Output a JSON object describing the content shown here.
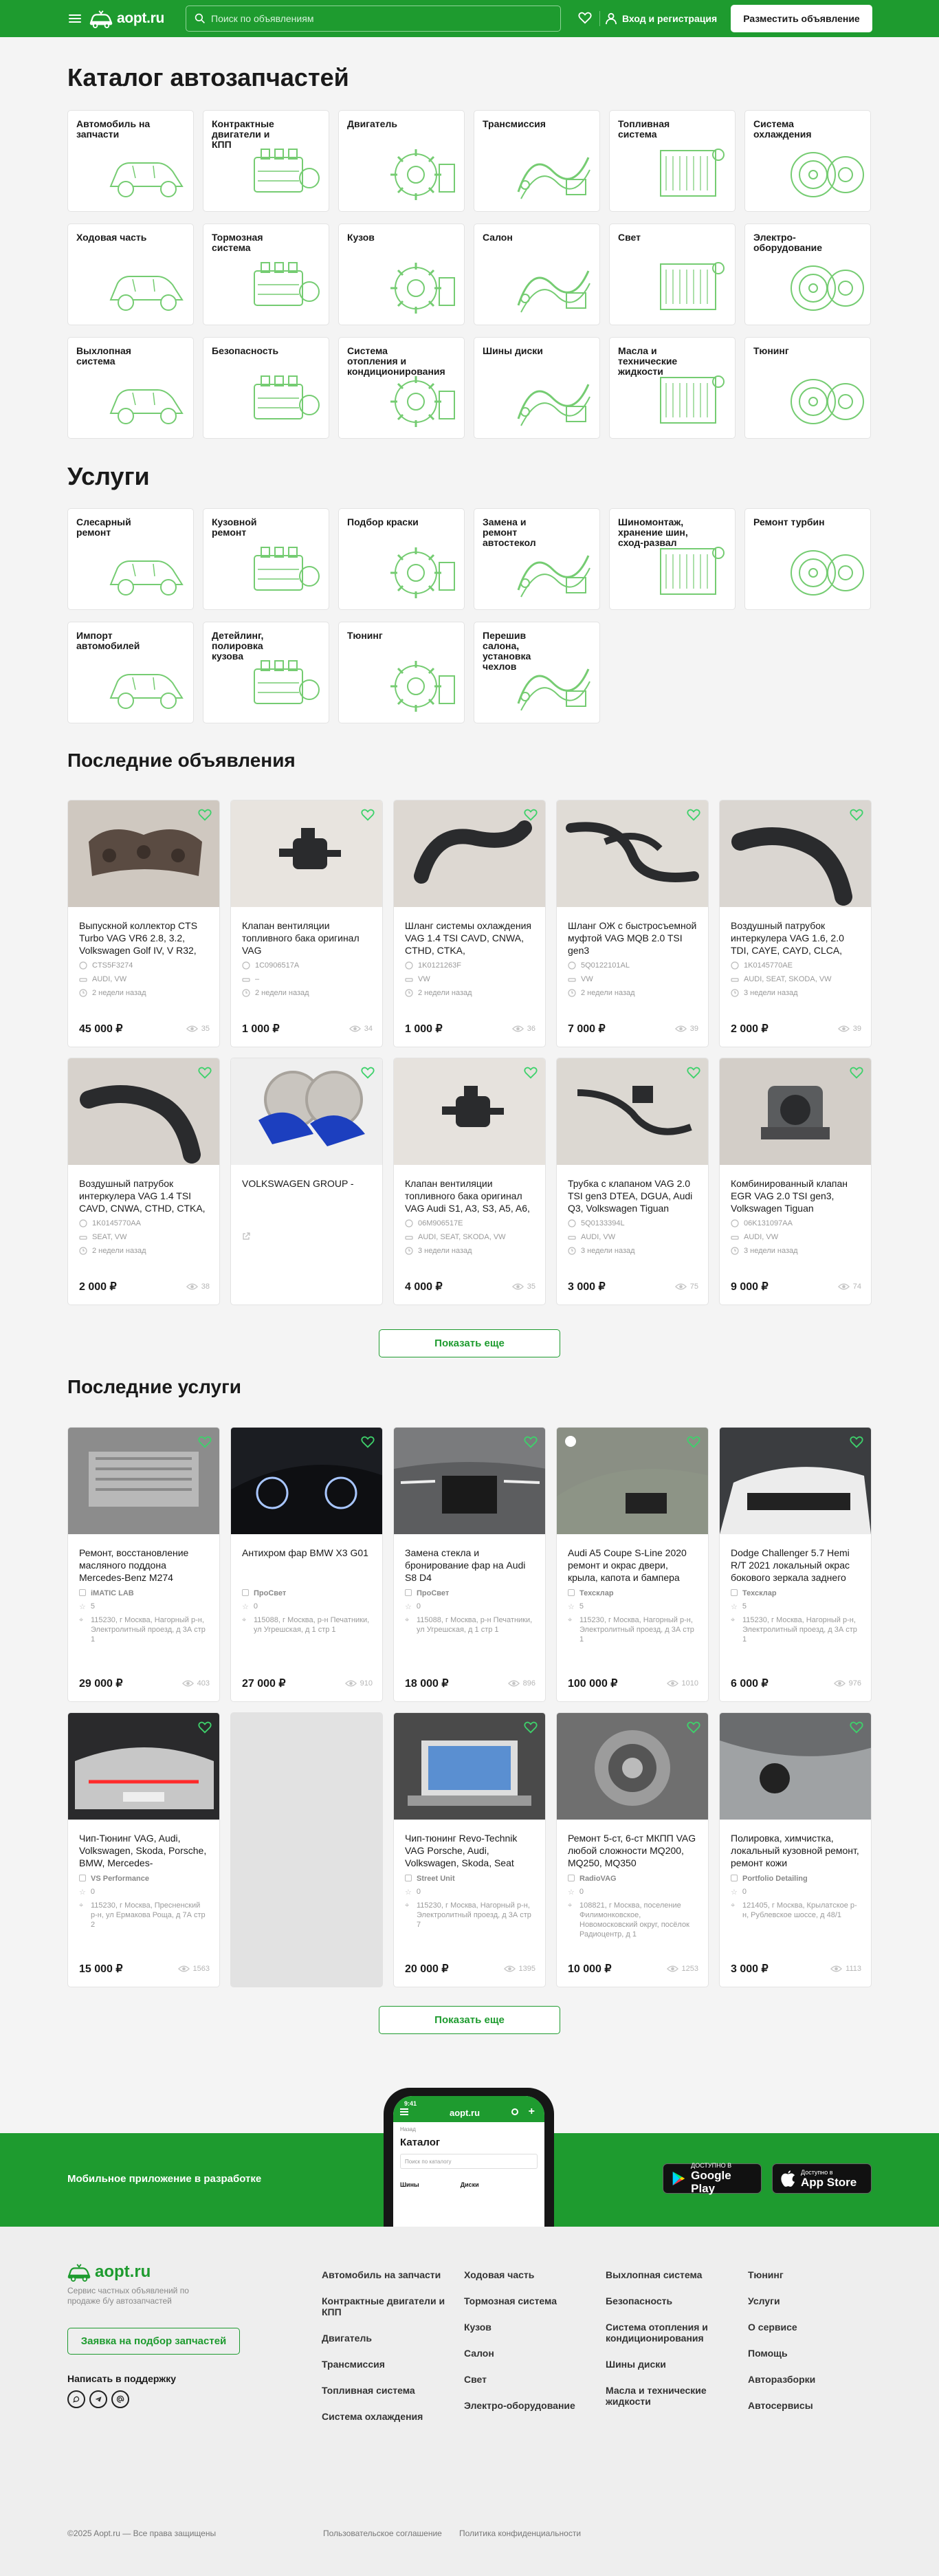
{
  "header": {
    "logo_text": "aopt.ru",
    "search_placeholder": "Поиск по объявлениям",
    "login_label": "Вход и регистрация",
    "post_button": "Разместить объявление"
  },
  "catalog": {
    "title": "Каталог автозапчастей",
    "items": [
      {
        "label": "Автомобиль на запчасти",
        "icon": "car-parts-icon"
      },
      {
        "label": "Контрактные двигатели и КПП",
        "icon": "engine-gearbox-icon"
      },
      {
        "label": "Двигатель",
        "icon": "engine-icon"
      },
      {
        "label": "Трансмиссия",
        "icon": "transmission-icon"
      },
      {
        "label": "Топливная система",
        "icon": "fuel-system-icon"
      },
      {
        "label": "Система охлаждения",
        "icon": "cooling-system-icon"
      },
      {
        "label": "Ходовая часть",
        "icon": "suspension-icon"
      },
      {
        "label": "Тормозная система",
        "icon": "brake-icon"
      },
      {
        "label": "Кузов",
        "icon": "car-body-icon"
      },
      {
        "label": "Салон",
        "icon": "car-interior-icon"
      },
      {
        "label": "Свет",
        "icon": "headlight-icon"
      },
      {
        "label": "Электро-оборудование",
        "icon": "electrical-icon"
      },
      {
        "label": "Выхлопная система",
        "icon": "exhaust-icon"
      },
      {
        "label": "Безопасность",
        "icon": "safety-icon"
      },
      {
        "label": "Система отопления и кондиционирования",
        "icon": "ac-heating-icon"
      },
      {
        "label": "Шины диски",
        "icon": "tires-wheels-icon"
      },
      {
        "label": "Масла и технические жидкости",
        "icon": "oils-fluids-icon"
      },
      {
        "label": "Тюнинг",
        "icon": "tuning-icon"
      }
    ]
  },
  "services": {
    "title": "Услуги",
    "items": [
      {
        "label": "Слесарный ремонт",
        "icon": "mechanic-icon"
      },
      {
        "label": "Кузовной ремонт",
        "icon": "body-repair-icon"
      },
      {
        "label": "Подбор краски",
        "icon": "paint-match-icon"
      },
      {
        "label": "Замена и ремонт автостекол",
        "icon": "windshield-icon"
      },
      {
        "label": "Шиномонтаж, хранение шин, сход-развал",
        "icon": "tire-service-icon"
      },
      {
        "label": "Ремонт турбин",
        "icon": "turbo-icon"
      },
      {
        "label": "Импорт автомобилей",
        "icon": "car-import-icon"
      },
      {
        "label": "Детейлинг, полировка кузова",
        "icon": "detailing-icon"
      },
      {
        "label": "Тюнинг",
        "icon": "tuning-service-icon"
      },
      {
        "label": "Перешив салона, установка чехлов",
        "icon": "upholstery-icon"
      }
    ]
  },
  "listings": {
    "title": "Последние объявления",
    "show_more": "Показать еще",
    "items": [
      {
        "title": "Выпускной коллектор CTS Turbo VAG VR6 2.8, 3.2, Volkswagen Golf IV, V R32,",
        "code": "CTS5F3274",
        "brands": "AUDI, VW",
        "date": "2 недели назад",
        "price": "45 000 ₽",
        "views": "35",
        "img": "manifold"
      },
      {
        "title": "Клапан вентиляции топливного бака оригинал VAG",
        "code": "1C0906517A",
        "brands": "–",
        "date": "2 недели назад",
        "price": "1 000 ₽",
        "views": "34",
        "img": "valve"
      },
      {
        "title": "Шланг системы охлаждения VAG 1.4 TSI CAVD, CNWA, CTHD, CTKA,",
        "code": "1K0121263F",
        "brands": "VW",
        "date": "2 недели назад",
        "price": "1 000 ₽",
        "views": "36",
        "img": "hose"
      },
      {
        "title": "Шланг ОЖ с быстросъемной муфтой VAG MQB 2.0 TSI gen3",
        "code": "5Q0122101AL",
        "brands": "VW",
        "date": "2 недели назад",
        "price": "7 000 ₽",
        "views": "39",
        "img": "hose2"
      },
      {
        "title": "Воздушный патрубок интеркулера VAG 1.6, 2.0 TDI, CAYE, CAYD, CLCA,",
        "code": "1K0145770AE",
        "brands": "AUDI, SEAT, SKODA, VW",
        "date": "3 недели назад",
        "price": "2 000 ₽",
        "views": "39",
        "img": "pipe"
      },
      {
        "title": "Воздушный патрубок интеркулера VAG 1.4 TSI CAVD, CNWA, CTHD, CTKA,",
        "code": "1K0145770AA",
        "brands": "SEAT, VW",
        "date": "2 недели назад",
        "price": "2 000 ₽",
        "views": "38",
        "img": "pipe2"
      },
      {
        "title": "VOLKSWAGEN GROUP -",
        "code": "",
        "brands": "",
        "date": "",
        "price": "",
        "views": "",
        "img": "brakes"
      },
      {
        "title": "Клапан вентиляции топливного бака оригинал VAG Audi S1, A3, S3, A5, A6,",
        "code": "06M906517E",
        "brands": "AUDI, SEAT, SKODA, VW",
        "date": "3 недели назад",
        "price": "4 000 ₽",
        "views": "35",
        "img": "valve2"
      },
      {
        "title": "Трубка с клапаном VAG 2.0 TSI gen3 DTEA, DGUA, Audi Q3, Volkswagen Tiguan",
        "code": "5Q0133394L",
        "brands": "AUDI, VW",
        "date": "3 недели назад",
        "price": "3 000 ₽",
        "views": "75",
        "img": "tube"
      },
      {
        "title": "Комбинированный клапан EGR VAG 2.0 TSI gen3, Volkswagen Tiguan",
        "code": "06K131097AA",
        "brands": "AUDI, VW",
        "date": "3 недели назад",
        "price": "9 000 ₽",
        "views": "74",
        "img": "egr"
      }
    ]
  },
  "latest_services": {
    "title": "Последние услуги",
    "show_more": "Показать еще",
    "items": [
      {
        "title": "Ремонт, восстановление масляного поддона Mercedes-Benz M274",
        "seller": "iMATIC LAB",
        "rating": "5",
        "address": "115230, г Москва, Нагорный р-н, Электролитный проезд, д 3А стр 1",
        "price": "29 000 ₽",
        "views": "403",
        "img": "oilpan"
      },
      {
        "title": "Антихром фар BMW X3 G01",
        "seller": "ПроСвет",
        "rating": "0",
        "address": "115088, г Москва, р-н Печатники, ул Угрешская, д 1 стр 1",
        "price": "27 000 ₽",
        "views": "910",
        "img": "bmw"
      },
      {
        "title": "Замена стекла и бронирование фар на Audi S8 D4",
        "seller": "ПроСвет",
        "rating": "0",
        "address": "115088, г Москва, р-н Печатники, ул Угрешская, д 1 стр 1",
        "price": "18 000 ₽",
        "views": "896",
        "img": "audi"
      },
      {
        "title": "Audi A5 Coupe S-Line 2020 ремонт и окрас двери, крыла, капота и бампера",
        "seller": "Техсклар",
        "rating": "5",
        "address": "115230, г Москва, Нагорный р-н, Электролитный проезд, д 3А стр 1",
        "price": "100 000 ₽",
        "views": "1010",
        "img": "a5"
      },
      {
        "title": "Dodge Challenger 5.7 Hemi R/T 2021 локальный окрас бокового зеркала заднего",
        "seller": "Техсклар",
        "rating": "5",
        "address": "115230, г Москва, Нагорный р-н, Электролитный проезд, д 3А стр 1",
        "price": "6 000 ₽",
        "views": "976",
        "img": "dodge"
      },
      {
        "title": "Чип-Тюнинг VAG, Audi, Volkswagen, Skoda, Porsche, BMW, Mercedes-",
        "seller": "VS Performance",
        "rating": "0",
        "address": "115230, г Москва, Пресненский р-н, ул Ермакова Роща, д 7А стр 2",
        "price": "15 000 ₽",
        "views": "1563",
        "img": "audirear"
      },
      {
        "title": "",
        "seller": "",
        "rating": "",
        "address": "",
        "price": "",
        "views": "",
        "img": "blank"
      },
      {
        "title": "Чип-тюнинг Revo-Technik VAG Porsche, Audi, Volkswagen, Skoda, Seat",
        "seller": "Street Unit",
        "rating": "0",
        "address": "115230, г Москва, Нагорный р-н, Электролитный проезд, д 3А стр 7",
        "price": "20 000 ₽",
        "views": "1395",
        "img": "laptop"
      },
      {
        "title": "Ремонт 5-ст, 6-ст МКПП VAG любой сложности MQ200, MQ250, MQ350",
        "seller": "RadioVAG",
        "rating": "0",
        "address": "108821, г Москва, поселение Филимонковское, Новомосковский округ, посёлок Радиоцентр, д 1",
        "price": "10 000 ₽",
        "views": "1253",
        "img": "gearbox"
      },
      {
        "title": "Полировка, химчистка, локальный кузовной ремонт, ремонт кожи",
        "seller": "Portfolio Detailing",
        "rating": "0",
        "address": "121405, г Москва, Крылатское р-н, Рублевское шоссе, д 48/1",
        "price": "3 000 ₽",
        "views": "1113",
        "img": "polish"
      }
    ]
  },
  "mobile": {
    "text": "Мобильное приложение в разработке",
    "google_small": "ДОСТУПНО В",
    "google_big": "Google Play",
    "apple_small": "Доступно в",
    "apple_big": "App Store",
    "phone_time": "9:41",
    "phone_logo": "aopt.ru",
    "phone_back": "Назад",
    "phone_heading": "Каталог",
    "phone_search": "Поиск по каталогу",
    "phone_item1": "Шины",
    "phone_item2": "Диски"
  },
  "footer": {
    "logo_text": "aopt.ru",
    "tagline": "Сервис частных объявлений по продаже б/у автозапчастей",
    "request_button": "Заявка на подбор запчастей",
    "support": "Написать в поддержку",
    "col1": [
      "Автомобиль на запчасти",
      "Контрактные двигатели и КПП",
      "Двигатель",
      "Трансмиссия",
      "Топливная система",
      "Система охлаждения"
    ],
    "col2": [
      "Ходовая часть",
      "Тормозная система",
      "Кузов",
      "Салон",
      "Свет",
      "Электро-оборудование"
    ],
    "col3": [
      "Выхлопная система",
      "Безопасность",
      "Система отопления и кондиционирования",
      "Шины диски",
      "Масла и технические жидкости"
    ],
    "col4": [
      "Тюнинг",
      "Услуги",
      "О сервисе",
      "Помощь",
      "Авторазборки",
      "Автосервисы"
    ],
    "copyright": "©2025 Aopt.ru — Все права защищены",
    "terms": "Пользовательское соглашение",
    "privacy": "Политика конфиденциальности"
  },
  "colors": {
    "brand_green": "#1e9b2f",
    "line_art_green": "#5ec45a",
    "background": "#f4f4f4"
  }
}
